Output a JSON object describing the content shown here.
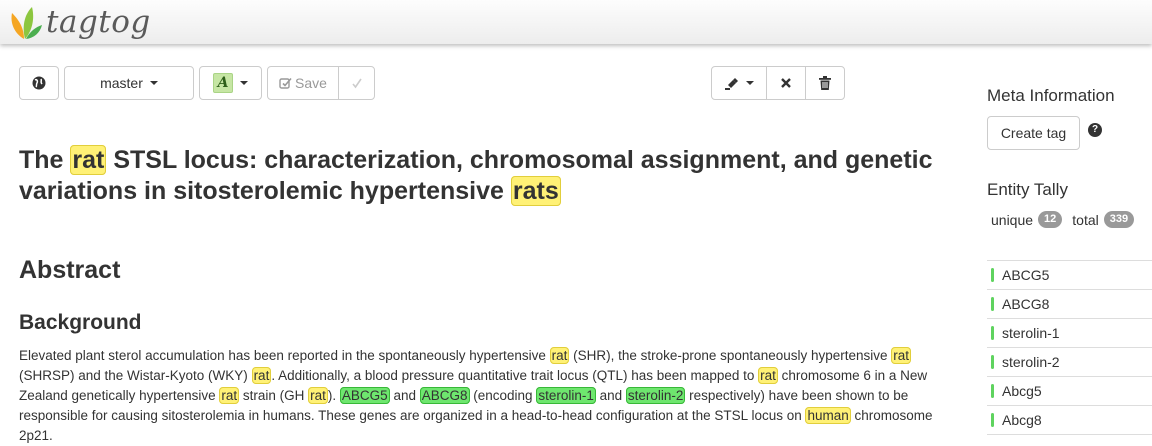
{
  "app": {
    "logo_text": "tagtog"
  },
  "toolbar": {
    "branch_label": "master",
    "save_label": "Save"
  },
  "document": {
    "title_parts": [
      "The ",
      "rat",
      " STSL locus: characterization, chromosomal assignment, and genetic variations in sitosterolemic hypertensive ",
      "rats"
    ],
    "abstract_heading": "Abstract",
    "background_heading": "Background",
    "para_parts": [
      "Elevated plant sterol accumulation has been reported in the spontaneously hypertensive ",
      "rat",
      " (SHR), the stroke-prone spontaneously hypertensive ",
      "rat",
      " (SHRSP) and the Wistar-Kyoto (WKY) ",
      "rat",
      ". Additionally, a blood pressure quantitative trait locus (QTL) has been mapped to ",
      "rat",
      " chromosome 6 in a New Zealand genetically hypertensive ",
      "rat",
      " strain (GH ",
      "rat",
      "). ",
      "ABCG5",
      " and ",
      "ABCG8",
      " (encoding ",
      "sterolin-1",
      " and ",
      "sterolin-2",
      " respectively) have been shown to be responsible for causing sitosterolemia in humans. These genes are organized in a head-to-head configuration at the STSL locus on ",
      "human",
      " chromosome 2p21."
    ]
  },
  "sidebar": {
    "meta_heading": "Meta Information",
    "create_tag_label": "Create tag",
    "help_symbol": "?",
    "tally_heading": "Entity Tally",
    "unique_label": "unique",
    "unique_count": "12",
    "total_label": "total",
    "total_count": "339",
    "entities": [
      "ABCG5",
      "ABCG8",
      "sterolin-1",
      "sterolin-2",
      "Abcg5",
      "Abcg8"
    ]
  },
  "colors": {
    "entity_species": "#fff176",
    "entity_gene": "#6ee66e",
    "entity_bar": "#5fd35f",
    "badge": "#999999"
  }
}
